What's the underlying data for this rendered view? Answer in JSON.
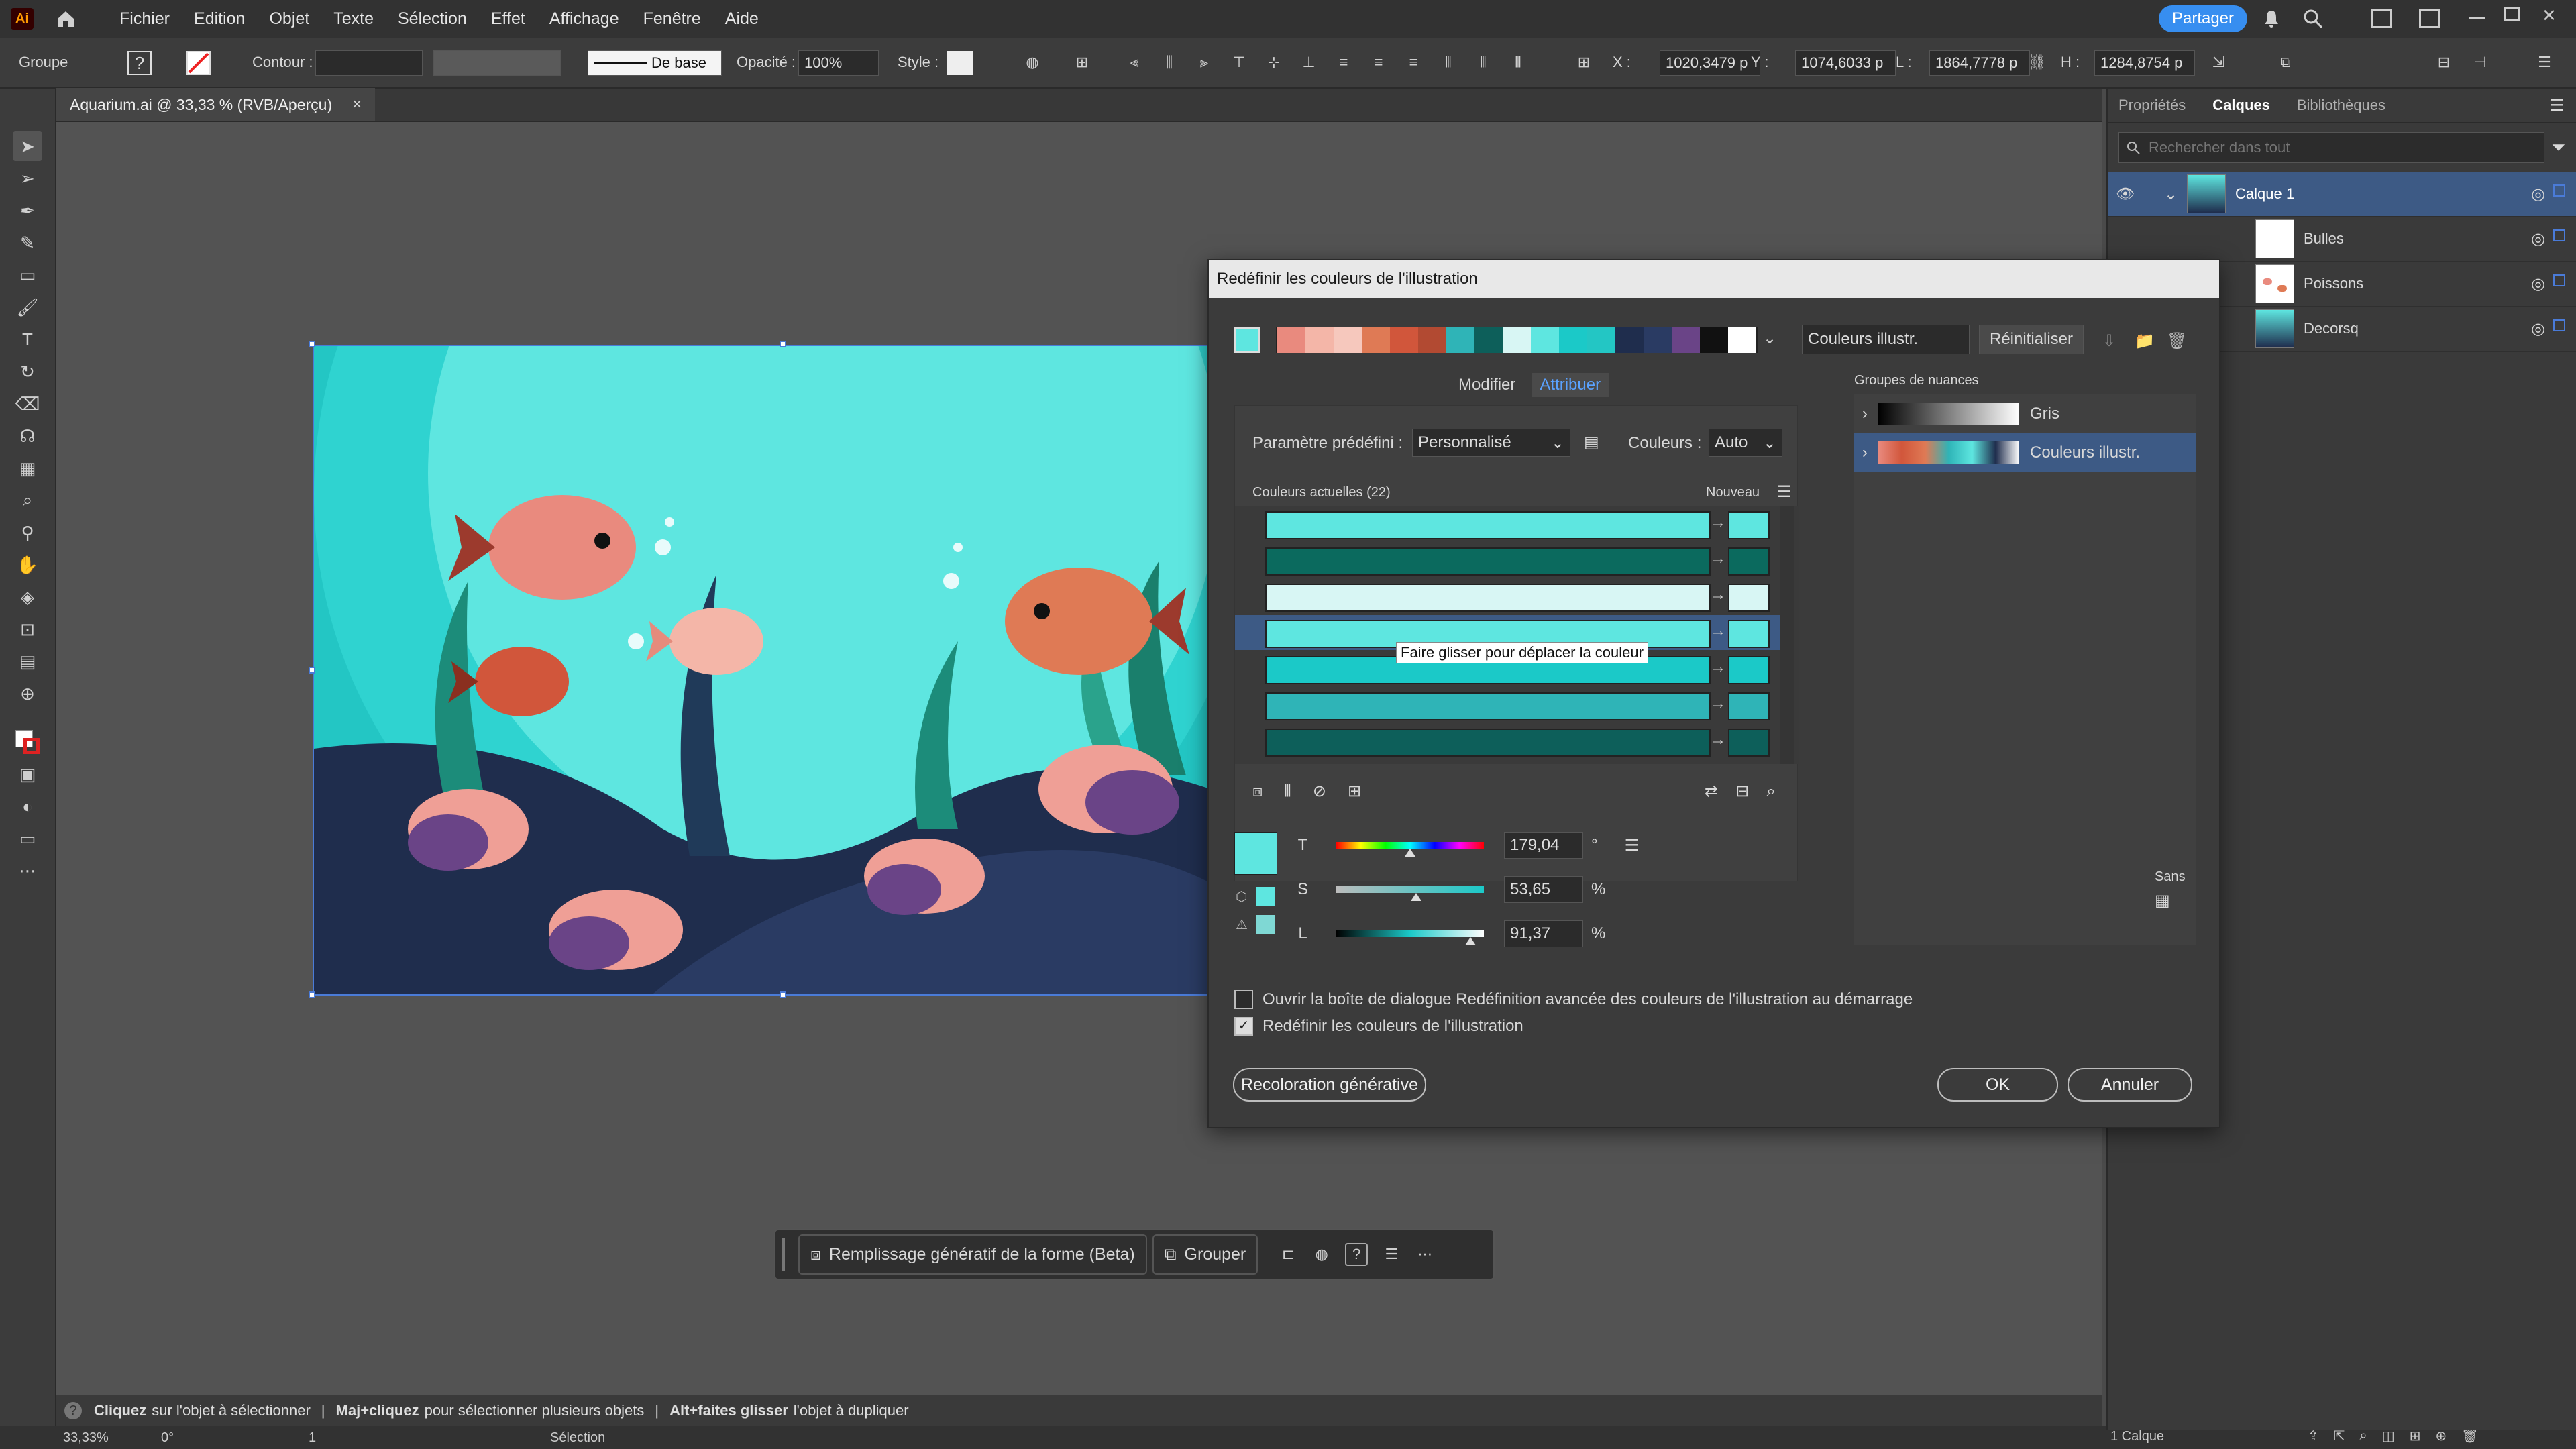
{
  "menubar": {
    "app_badge": "Ai",
    "items": [
      "Fichier",
      "Edition",
      "Objet",
      "Texte",
      "Sélection",
      "Effet",
      "Affichage",
      "Fenêtre",
      "Aide"
    ],
    "share_label": "Partager"
  },
  "controlbar": {
    "object_type": "Groupe",
    "contour_label": "Contour :",
    "stroke_style": "De base",
    "opacity_label": "Opacité :",
    "opacity_value": "100%",
    "style_label": "Style :",
    "x_label": "X :",
    "x_value": "1020,3479 p",
    "y_label": "Y :",
    "y_value": "1074,6033 p",
    "w_label": "L :",
    "w_value": "1864,7778 p",
    "h_label": "H :",
    "h_value": "1284,8754 p"
  },
  "document": {
    "tab_title": "Aquarium.ai @ 33,33 % (RVB/Aperçu)",
    "close_glyph": "×"
  },
  "right_panel": {
    "tabs": [
      "Propriétés",
      "Calques",
      "Bibliothèques"
    ],
    "active_tab": "Calques",
    "search_placeholder": "Rechercher dans tout",
    "layers": [
      {
        "name": "Calque 1",
        "level": 0
      },
      {
        "name": "Bulles",
        "level": 1
      },
      {
        "name": "Poissons",
        "level": 1
      },
      {
        "name": "Decorsq",
        "level": 1
      }
    ],
    "footer_count": "1 Calque"
  },
  "dialog": {
    "title": "Redéfinir les couleurs de l'illustration",
    "group_name": "Couleurs illustr.",
    "reset_label": "Réinitialiser",
    "tabs": [
      "Modifier",
      "Attribuer"
    ],
    "active_tab": "Attribuer",
    "preset_label": "Paramètre prédéfini :",
    "preset_value": "Personnalisé",
    "colors_label": "Couleurs :",
    "colors_value": "Auto",
    "current_colors_label": "Couleurs actuelles (22)",
    "new_label": "Nouveau",
    "tooltip": "Faire glisser pour déplacer la couleur",
    "swatch_groups_label": "Groupes de nuances",
    "swatch_groups": [
      "Gris",
      "Couleurs illustr."
    ],
    "sans_label": "Sans",
    "hsl": [
      {
        "label": "T",
        "value": "179,04",
        "unit": "°",
        "fraction": 0.5
      },
      {
        "label": "S",
        "value": "53,65",
        "unit": "%",
        "fraction": 0.54
      },
      {
        "label": "L",
        "value": "91,37",
        "unit": "%",
        "fraction": 0.91
      }
    ],
    "check_advanced": "Ouvrir la boîte de dialogue Redéfinition avancée des couleurs de l'illustration au démarrage",
    "check_recolor": "Redéfinir les couleurs de l'illustration",
    "generative_label": "Recoloration générative",
    "ok_label": "OK",
    "cancel_label": "Annuler",
    "rows": [
      {
        "current": "#5ee6e0",
        "new": "#5ee6e0",
        "selected": false
      },
      {
        "current": "#0b6a5e",
        "new": "#0b6a5e",
        "selected": false
      },
      {
        "current": "#d8f6f4",
        "new": "#d8f6f4",
        "selected": false
      },
      {
        "current": "#5ee6e0",
        "new": "#5ee6e0",
        "selected": true
      },
      {
        "current": "#1bc9c8",
        "new": "#1bc9c8",
        "selected": false
      },
      {
        "current": "#2fb4b7",
        "new": "#2fb4b7",
        "selected": false
      },
      {
        "current": "#0d5f5a",
        "new": "#0d5f5a",
        "selected": false
      }
    ]
  },
  "context_bar": {
    "generative_fill": "Remplissage génératif de la forme (Beta)",
    "group_label": "Grouper"
  },
  "statusbar": {
    "hint_1_bold": "Cliquez",
    "hint_1": "sur l'objet à sélectionner",
    "hint_2_bold": "Maj+cliquez",
    "hint_2": "pour sélectionner plusieurs objets",
    "hint_3_bold": "Alt+faites glisser",
    "hint_3": "l'objet à dupliquer"
  },
  "bottombar": {
    "zoom": "33,33%",
    "rotation": "0°",
    "artboard": "1",
    "mode": "Sélection"
  },
  "colors": {
    "accent": "#378ef0",
    "selected_layer": "#3d5a85",
    "sea_light": "#5ee6e0",
    "sea_dark": "#1f2d4d"
  }
}
